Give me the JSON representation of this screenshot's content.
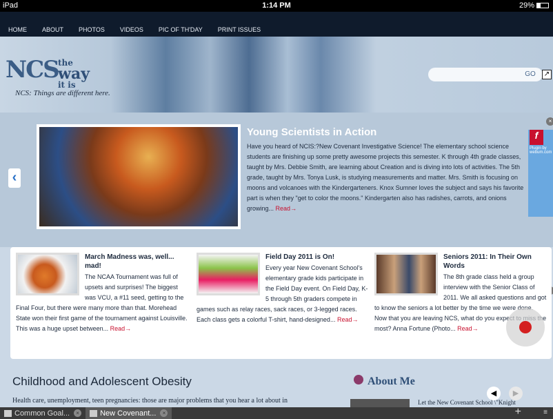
{
  "status": {
    "carrier": "iPad",
    "time": "1:14 PM",
    "battery": "29%"
  },
  "nav": [
    "HOME",
    "ABOUT",
    "PHOTOS",
    "VIDEOS",
    "PIC OF TH'DAY",
    "PRINT ISSUES"
  ],
  "header": {
    "logo": "NCS",
    "logo_the": "the",
    "logo_way": "way",
    "logo_itis": "it is",
    "tagline": "NCS: Things are different here.",
    "search_placeholder": "",
    "go_label": "GO"
  },
  "featured": {
    "title": "Young Scientists in Action",
    "text": "Have you heard of NCIS:?New Covenant Investigative Science! The elementary school science students are finishing up some pretty awesome projects this semester.  K through 4th grade classes, taught by Mrs. Debbie Smith, are learning about Creation and is diving into lots of activities.  The 5th grade, taught by Mrs. Tonya Lusk, is studying measurements and matter.  Mrs. Smith is focusing on moons and volcanoes with the Kindergarteners. Knox Sumner loves the subject and says his favorite part is when they \"get to color the moons.\"  Kindergarten also has radishes, carrots, and onions growing...",
    "read_more": "Read→"
  },
  "flash": {
    "text": "Plugin by webum.com"
  },
  "cards": [
    {
      "title": "March Madness was, well... mad!",
      "text": "The NCAA Tournament was full of upsets and surprises! The biggest was VCU, a #11 seed, getting to the Final Four, but there were many more than that. Morehead State won their first game of the tournament against Louisville. This was a huge upset between...",
      "read_more": "Read→"
    },
    {
      "title": "Field Day 2011 is On!",
      "text": "Every year New Covenant School's elementary grade kids participate in the Field Day event.  On Field Day, K-5 through 5th graders compete in games such as relay races, sack races, or 3-legged races.  Each class gets a colorful T-shirt, hand-designed...",
      "read_more": "Read→"
    },
    {
      "title": "Seniors 2011: In Their Own Words",
      "text": "The 8th grade class held a group interview with the Senior Class of 2011. We all asked questions and got to know the seniors a lot better by the time we were done. Now that you are leaving NCS, what do you expect to miss the most? Anna Fortune (Photo...",
      "read_more": "Read→"
    }
  ],
  "obesity": {
    "title": "Childhood and Adolescent Obesity",
    "text": "Health care, unemployment, teen pregnancies: those are major problems that you hear a lot about in"
  },
  "about": {
    "title": "About Me",
    "text": "Let the New Covenant School \\\"Knight"
  },
  "tabs": [
    {
      "label": "Common Goal..."
    },
    {
      "label": "New Covenant..."
    }
  ],
  "tabbar": {
    "plus": "+",
    "menu": "≡"
  }
}
